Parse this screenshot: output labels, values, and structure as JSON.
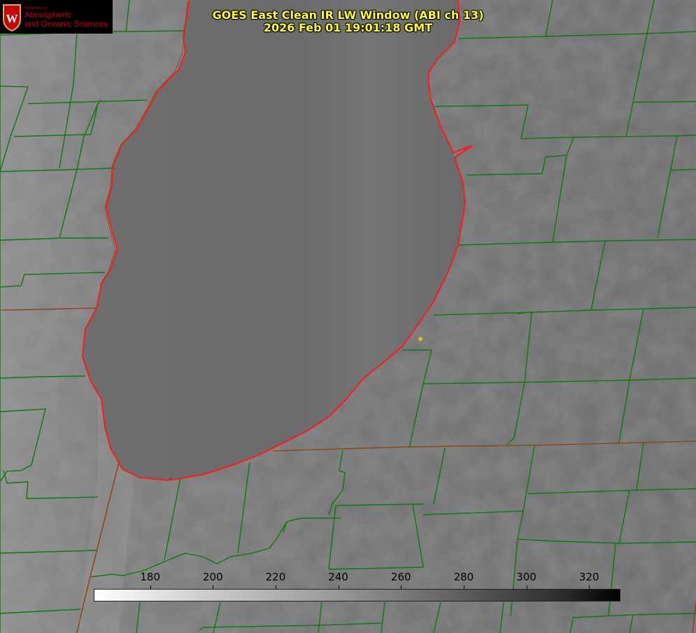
{
  "title": {
    "line1": "GOES East Clean IR LW Window (ABI ch 13)",
    "line2": "2026 Feb 01 19:01:18 GMT"
  },
  "logo": {
    "department_small": "Department of",
    "line1": "Atmospheric",
    "line2": "and Oceanic Sciences",
    "shield_letter": "W"
  },
  "colorbar": {
    "ticks": [
      "180",
      "200",
      "220",
      "240",
      "260",
      "280",
      "300",
      "320"
    ],
    "tick_values": [
      180,
      200,
      220,
      240,
      260,
      280,
      300,
      320
    ],
    "min_value": 162,
    "max_value": 330,
    "colormap": "white-to-black"
  },
  "colors": {
    "boundary_county": "#0a7a0a",
    "boundary_state": "#8a4a1a",
    "coastline": "#ff1a1a",
    "title": "#ffff3c",
    "marker": "#d4c020",
    "logo_red": "#c5050c"
  },
  "features": {
    "marker_dot": true
  }
}
